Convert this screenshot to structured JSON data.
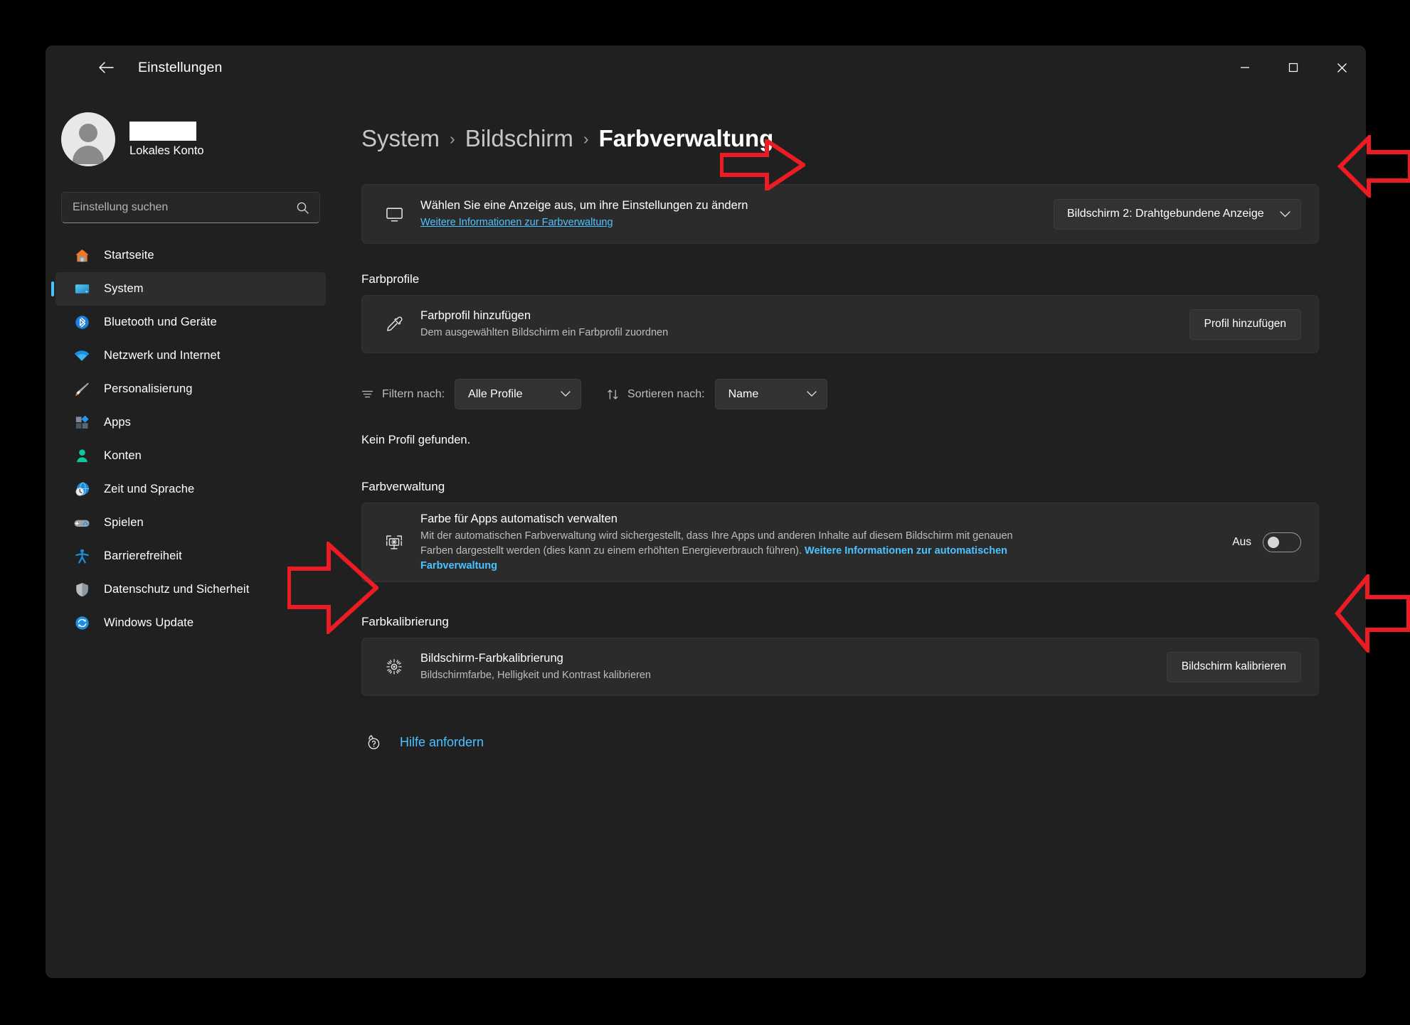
{
  "window": {
    "title": "Einstellungen",
    "back_icon": "back-arrow-icon",
    "minimize_label": "Minimieren",
    "maximize_label": "Maximieren",
    "close_label": "Schließen"
  },
  "sidebar": {
    "account": {
      "name_redacted": "",
      "subtitle": "Lokales Konto"
    },
    "search": {
      "placeholder": "Einstellung suchen",
      "value": "",
      "icon": "search-icon"
    },
    "items": [
      {
        "label": "Startseite",
        "icon": "home-icon",
        "active": false
      },
      {
        "label": "System",
        "icon": "system-monitor-icon",
        "active": true
      },
      {
        "label": "Bluetooth und Geräte",
        "icon": "bluetooth-icon",
        "active": false
      },
      {
        "label": "Netzwerk und Internet",
        "icon": "wifi-icon",
        "active": false
      },
      {
        "label": "Personalisierung",
        "icon": "paintbrush-icon",
        "active": false
      },
      {
        "label": "Apps",
        "icon": "apps-icon",
        "active": false
      },
      {
        "label": "Konten",
        "icon": "user-account-icon",
        "active": false
      },
      {
        "label": "Zeit und Sprache",
        "icon": "clock-globe-icon",
        "active": false
      },
      {
        "label": "Spielen",
        "icon": "gamepad-icon",
        "active": false
      },
      {
        "label": "Barrierefreiheit",
        "icon": "accessibility-icon",
        "active": false
      },
      {
        "label": "Datenschutz und Sicherheit",
        "icon": "shield-icon",
        "active": false
      },
      {
        "label": "Windows Update",
        "icon": "update-refresh-icon",
        "active": false
      }
    ]
  },
  "breadcrumb": {
    "level1": "System",
    "separator": "›",
    "level2": "Bildschirm",
    "current": "Farbverwaltung"
  },
  "display_selector": {
    "icon": "monitor-icon",
    "title": "Wählen Sie eine Anzeige aus, um ihre Einstellungen zu ändern",
    "link": "Weitere Informationen zur Farbverwaltung",
    "dropdown_value": "Bildschirm 2: Drahtgebundene Anzeige",
    "dropdown_chevron": "chevron-down-icon"
  },
  "color_profiles": {
    "heading": "Farbprofile",
    "icon": "eyedropper-icon",
    "title": "Farbprofil hinzufügen",
    "subtitle": "Dem ausgewählten Bildschirm ein Farbprofil zuordnen",
    "button": "Profil hinzufügen",
    "filter_icon": "filter-lines-icon",
    "filter_label": "Filtern nach:",
    "filter_value": "Alle Profile",
    "sort_icon": "sort-arrows-icon",
    "sort_label": "Sortieren nach:",
    "sort_value": "Name",
    "empty_message": "Kein Profil gefunden."
  },
  "color_management": {
    "heading": "Farbverwaltung",
    "icon": "auto-color-monitor-icon",
    "title": "Farbe für Apps automatisch verwalten",
    "description_part1": "Mit der automatischen Farbverwaltung wird sichergestellt, dass Ihre Apps und anderen Inhalte auf diesem Bildschirm mit genauen Farben dargestellt werden (dies kann zu einem erhöhten Energieverbrauch führen). ",
    "description_link": "Weitere Informationen zur automatischen Farbverwaltung",
    "toggle_state": "Aus",
    "toggle_on": false
  },
  "color_calibration": {
    "heading": "Farbkalibrierung",
    "icon": "brightness-sun-icon",
    "title": "Bildschirm-Farbkalibrierung",
    "subtitle": "Bildschirmfarbe, Helligkeit und Kontrast kalibrieren",
    "button": "Bildschirm kalibrieren"
  },
  "help": {
    "icon": "help-question-icon",
    "label": "Hilfe anfordern"
  },
  "annotations": {
    "color": "#ED1C24",
    "arrows": [
      {
        "name": "arrow-pointing-to-display-dropdown-left",
        "direction": "right"
      },
      {
        "name": "arrow-pointing-to-display-dropdown-right",
        "direction": "left"
      },
      {
        "name": "arrow-pointing-to-color-management-card",
        "direction": "right"
      },
      {
        "name": "arrow-pointing-to-auto-color-toggle",
        "direction": "left"
      }
    ]
  }
}
